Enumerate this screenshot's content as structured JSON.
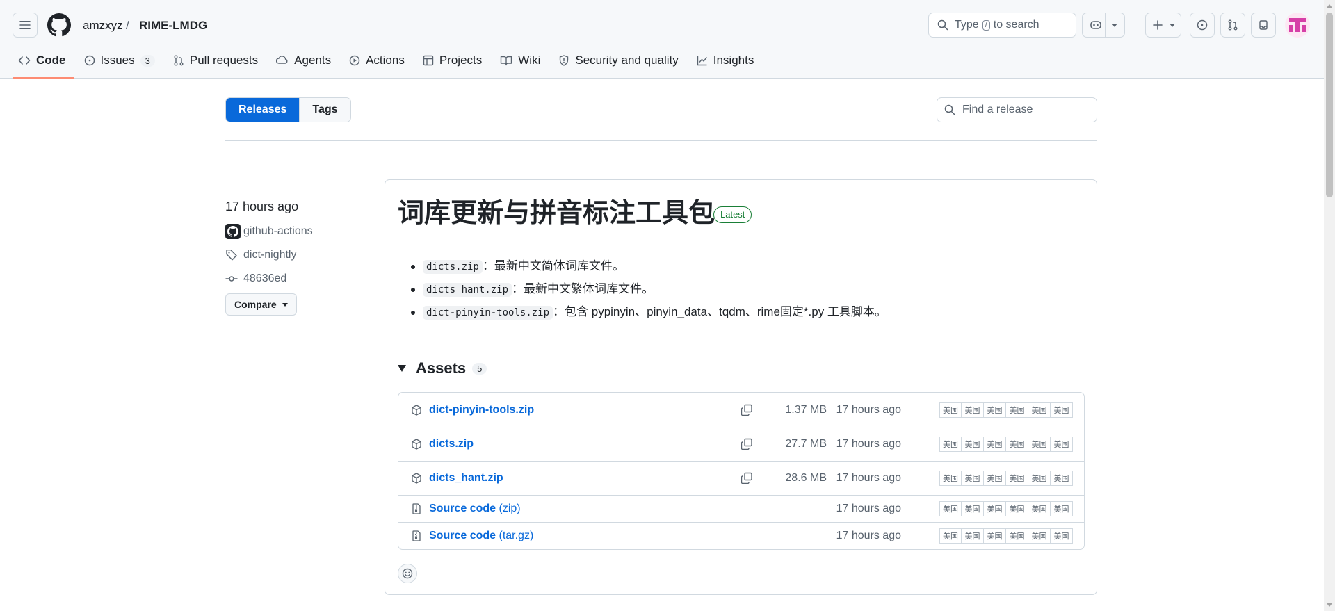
{
  "header": {
    "owner": "amzxyz",
    "separator": "/",
    "repo": "RIME-LMDG",
    "search": {
      "type_label": "Type",
      "key": "/",
      "to_search": "to search"
    }
  },
  "tabs": [
    {
      "label": "Code",
      "icon": "code-icon",
      "selected": true
    },
    {
      "label": "Issues",
      "icon": "issue-icon",
      "count": "3"
    },
    {
      "label": "Pull requests",
      "icon": "pull-request-icon"
    },
    {
      "label": "Agents",
      "icon": "agents-icon"
    },
    {
      "label": "Actions",
      "icon": "play-icon"
    },
    {
      "label": "Projects",
      "icon": "table-icon"
    },
    {
      "label": "Wiki",
      "icon": "book-icon"
    },
    {
      "label": "Security and quality",
      "icon": "shield-icon"
    },
    {
      "label": "Insights",
      "icon": "graph-icon"
    }
  ],
  "subnav": {
    "releases": "Releases",
    "tags": "Tags",
    "find_placeholder": "Find a release"
  },
  "meta": {
    "time": "17 hours ago",
    "author": "github-actions",
    "tag": "dict-nightly",
    "commit": "48636ed",
    "compare": "Compare"
  },
  "release": {
    "title": "词库更新与拼音标注工具包",
    "badge": "Latest",
    "notes": [
      {
        "code": "dicts.zip",
        "text": "：最新中文简体词库文件。"
      },
      {
        "code": "dicts_hant.zip",
        "text": "：最新中文繁体词库文件。"
      },
      {
        "code": "dict-pinyin-tools.zip",
        "text": "：包含 pypinyin、pinyin_data、tqdm、rime固定*.py 工具脚本。"
      }
    ],
    "assets_label": "Assets",
    "assets_count": "5",
    "flag_label": "美国",
    "assets": [
      {
        "name": "dict-pinyin-tools.zip",
        "size": "1.37 MB",
        "time": "17 hours ago",
        "icon": "package-icon"
      },
      {
        "name": "dicts.zip",
        "size": "27.7 MB",
        "time": "17 hours ago",
        "icon": "package-icon"
      },
      {
        "name": "dicts_hant.zip",
        "size": "28.6 MB",
        "time": "17 hours ago",
        "icon": "package-icon"
      },
      {
        "name": "Source code",
        "paren": "(zip)",
        "time": "17 hours ago",
        "icon": "file-zip-icon"
      },
      {
        "name": "Source code",
        "paren": "(tar.gz)",
        "time": "17 hours ago",
        "icon": "file-zip-icon"
      }
    ]
  },
  "colors": {
    "accent": "#0969da",
    "tab_underline": "#fd8c73",
    "latest_green": "#1a7f37",
    "avatar": "#d63fa7"
  }
}
